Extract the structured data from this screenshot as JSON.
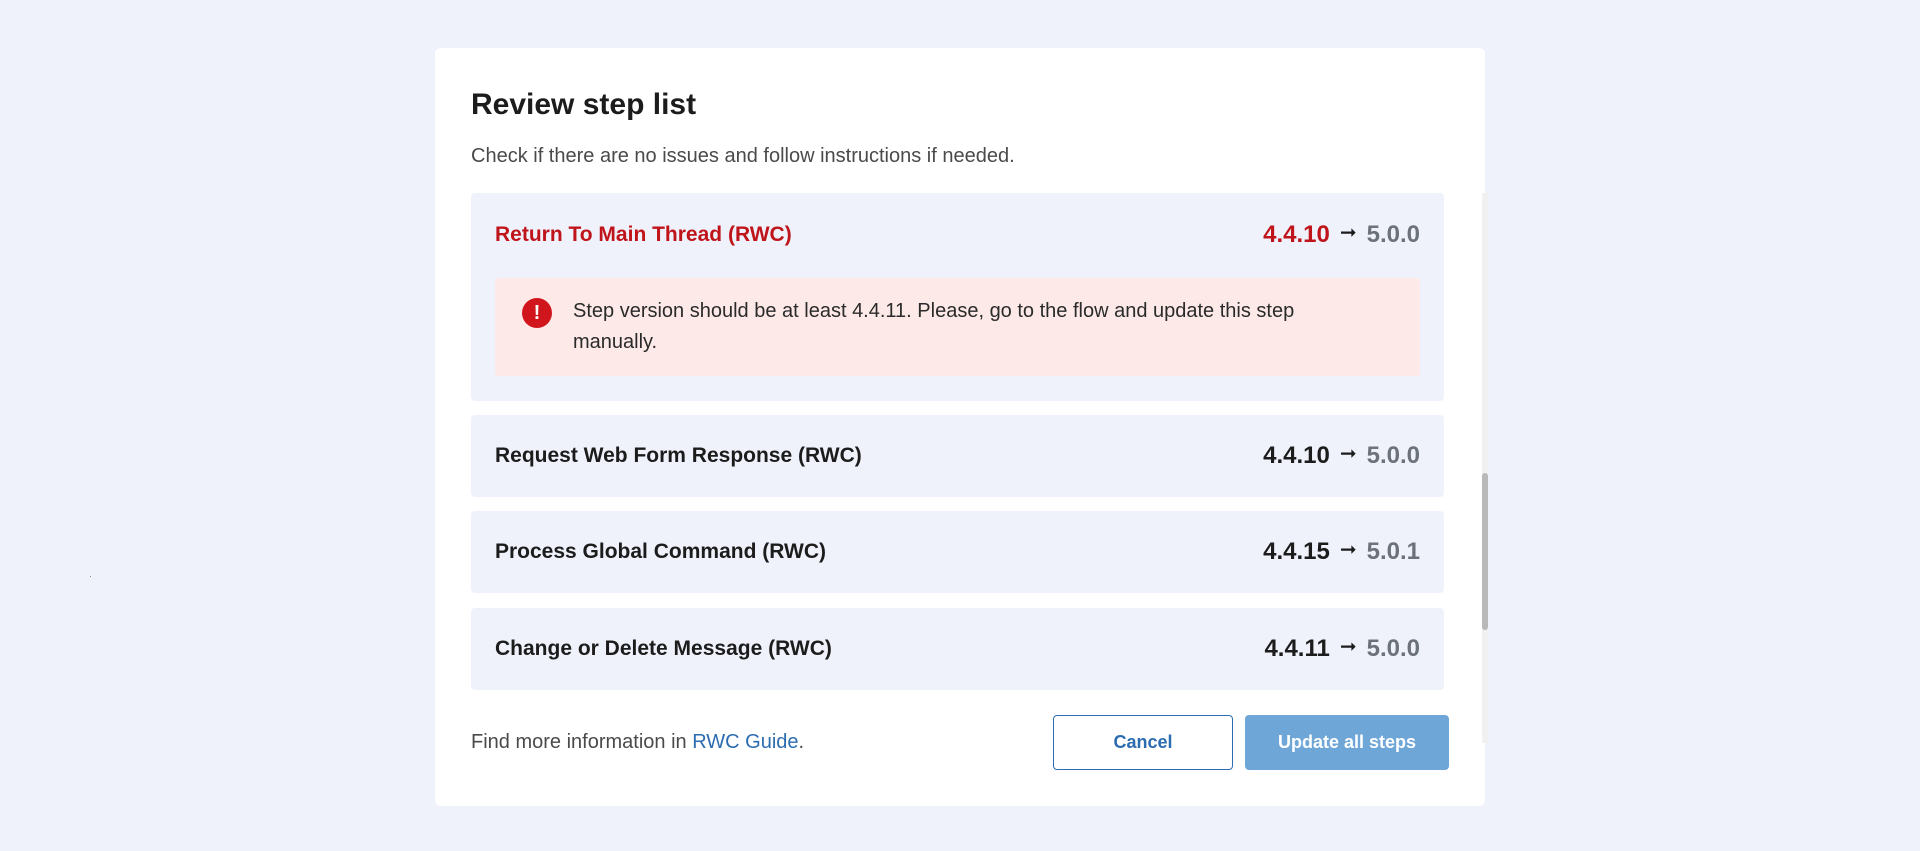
{
  "dialog": {
    "title": "Review step list",
    "subtitle": "Check if there are no issues and follow instructions if needed."
  },
  "steps": [
    {
      "name": "Return To Main Thread (RWC)",
      "from_version": "4.4.10",
      "arrow": "➞",
      "to_version": "5.0.0",
      "status": "error",
      "alert": "Step version should be at least 4.4.11. Please, go to the flow and update this step manually."
    },
    {
      "name": "Request Web Form Response (RWC)",
      "from_version": "4.4.10",
      "arrow": "➞",
      "to_version": "5.0.0",
      "status": "ok"
    },
    {
      "name": "Process Global Command (RWC)",
      "from_version": "4.4.15",
      "arrow": "➞",
      "to_version": "5.0.1",
      "status": "ok"
    },
    {
      "name": "Change or Delete Message (RWC)",
      "from_version": "4.4.11",
      "arrow": "➞",
      "to_version": "5.0.0",
      "status": "ok"
    }
  ],
  "footer": {
    "info_prefix": "Find more information in ",
    "link_label": "RWC Guide",
    "info_suffix": ".",
    "cancel_label": "Cancel",
    "update_label": "Update all steps"
  },
  "icons": {
    "alert": "exclamation-circle-icon",
    "arrow": "right-arrow-icon"
  },
  "colors": {
    "error": "#c0141b",
    "accent": "#2c6cb0",
    "primary_button": "#6fa6d8",
    "card_bg": "#eff2fb",
    "alert_bg": "#fdeae8"
  }
}
